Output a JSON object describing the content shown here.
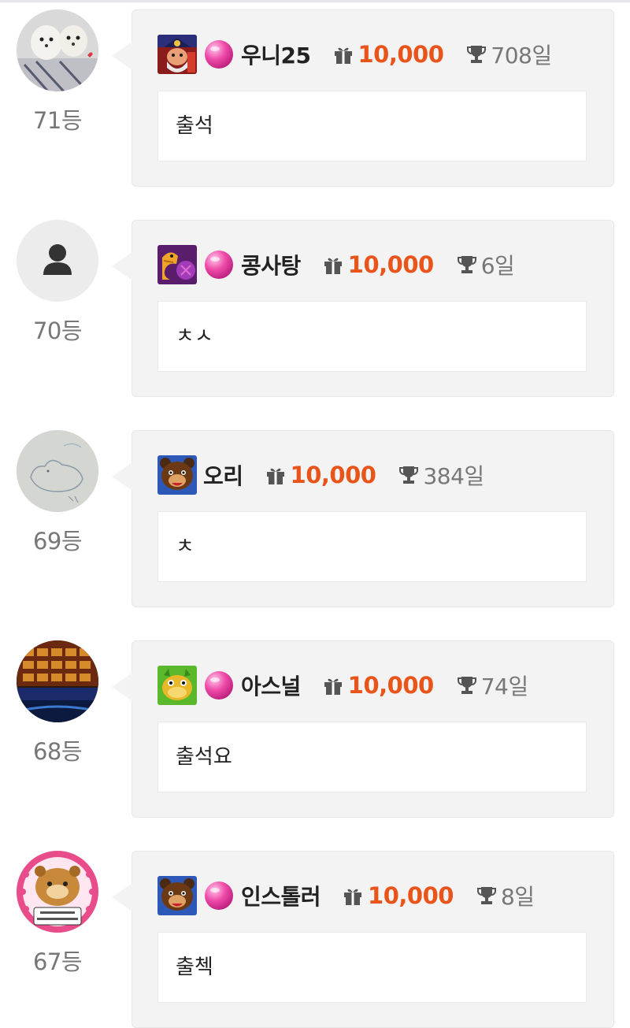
{
  "entries": [
    {
      "rank": "71등",
      "avatar": "avatar-dogs-photo",
      "game_icon": "pirate-icon",
      "has_badge": true,
      "nickname": "우니25",
      "points": "10,000",
      "days": "708일",
      "message": "출석"
    },
    {
      "rank": "70등",
      "avatar": "default-user-icon",
      "game_icon": "golden-dragon-icon",
      "has_badge": true,
      "nickname": "콩사탕",
      "points": "10,000",
      "days": "6일",
      "message": "ㅊㅅ"
    },
    {
      "rank": "69등",
      "avatar": "avatar-duck-sketch",
      "game_icon": "bear-icon",
      "has_badge": false,
      "nickname": "오리",
      "points": "10,000",
      "days": "384일",
      "message": "ㅊ"
    },
    {
      "rank": "68등",
      "avatar": "avatar-slot-machine",
      "game_icon": "green-dragon-icon",
      "has_badge": true,
      "nickname": "아스널",
      "points": "10,000",
      "days": "74일",
      "message": "출석요"
    },
    {
      "rank": "67등",
      "avatar": "avatar-hamster-sticker",
      "game_icon": "bear-icon",
      "has_badge": true,
      "nickname": "인스톨러",
      "points": "10,000",
      "days": "8일",
      "message": "출첵"
    }
  ],
  "colors": {
    "points": "#e8541a",
    "rank": "#777777",
    "bubble": "#f3f3f3",
    "badge": "#ee4aa8"
  }
}
